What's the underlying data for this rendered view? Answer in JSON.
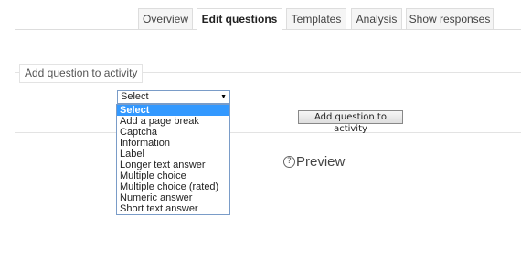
{
  "tabs": [
    {
      "label": "Overview",
      "active": false
    },
    {
      "label": "Edit questions",
      "active": true
    },
    {
      "label": "Templates",
      "active": false
    },
    {
      "label": "Analysis",
      "active": false
    },
    {
      "label": "Show responses",
      "active": false
    }
  ],
  "form": {
    "legend": "Add question to activity",
    "select": {
      "selected": "Select",
      "arrow": "▼",
      "options": [
        "Select",
        "Add a page break",
        "Captcha",
        "Information",
        "Label",
        "Longer text answer",
        "Multiple choice",
        "Multiple choice (rated)",
        "Numeric answer",
        "Short text answer"
      ]
    },
    "add_button": "Add question to activity"
  },
  "preview": {
    "icon": "help-icon",
    "icon_glyph": "?",
    "label": "Preview"
  },
  "colors": {
    "selection": "#3399ff",
    "border": "#dddddd"
  }
}
